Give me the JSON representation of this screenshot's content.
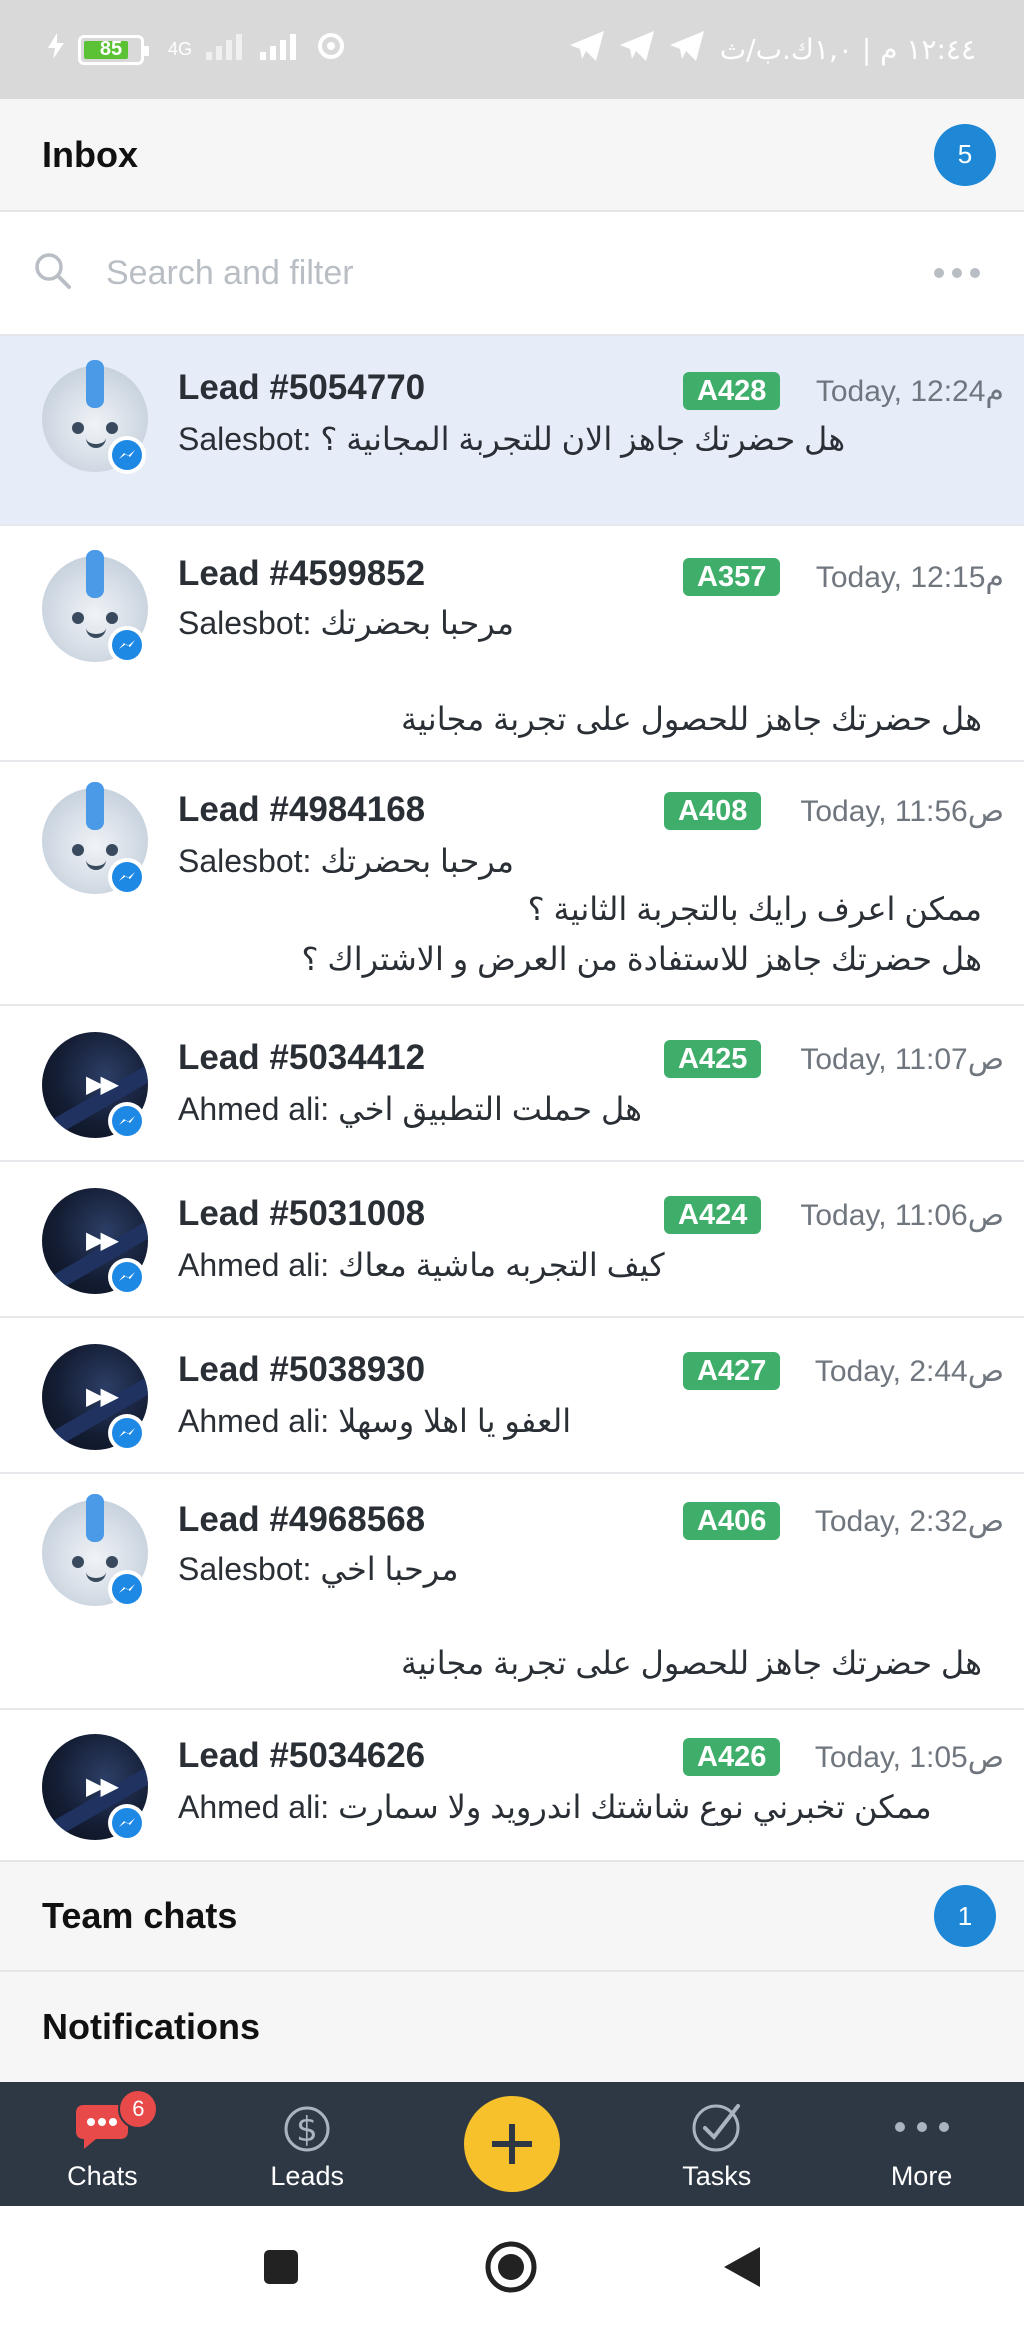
{
  "status_bar": {
    "right_text": "١٢:٤٤ م | ١,٠ك.ب/ث",
    "battery": "85",
    "network": "4G"
  },
  "inbox": {
    "title": "Inbox",
    "count": "5"
  },
  "search": {
    "placeholder": "Search and filter"
  },
  "conversations": [
    {
      "lead": "Lead #5054770",
      "tag": "A428",
      "time": "Today, 12:24م",
      "preview": "Salesbot: هل حضرتك جاهز الان للتجربة المجانية ؟",
      "extra": [],
      "avatar": "bot",
      "selected": true
    },
    {
      "lead": "Lead #4599852",
      "tag": "A357",
      "time": "Today, 12:15م",
      "preview": "Salesbot: مرحبا بحضرتك",
      "extra": [
        "هل حضرتك جاهز للحصول على تجربة مجانية"
      ],
      "avatar": "bot",
      "selected": false
    },
    {
      "lead": "Lead #4984168",
      "tag": "A408",
      "time": "Today, 11:56ص",
      "preview": "Salesbot: مرحبا بحضرتك",
      "extra": [
        "ممكن اعرف رايك بالتجربة الثانية ؟",
        "هل حضرتك جاهز للاستفادة من العرض و الاشتراك ؟"
      ],
      "avatar": "bot",
      "selected": false
    },
    {
      "lead": "Lead #5034412",
      "tag": "A425",
      "time": "Today, 11:07ص",
      "preview": "Ahmed ali: هل حملت التطبيق اخي",
      "extra": [],
      "avatar": "dark",
      "selected": false
    },
    {
      "lead": "Lead #5031008",
      "tag": "A424",
      "time": "Today, 11:06ص",
      "preview": "Ahmed ali: كيف التجربه ماشية معاك",
      "extra": [],
      "avatar": "dark",
      "selected": false
    },
    {
      "lead": "Lead #5038930",
      "tag": "A427",
      "time": "Today, 2:44ص",
      "preview": "Ahmed ali: العفو يا اهلا وسهلا",
      "extra": [],
      "avatar": "dark",
      "selected": false
    },
    {
      "lead": "Lead #4968568",
      "tag": "A406",
      "time": "Today, 2:32ص",
      "preview": "Salesbot: مرحبا اخي",
      "extra": [
        "هل حضرتك جاهز للحصول على تجربة مجانية"
      ],
      "avatar": "bot",
      "selected": false
    },
    {
      "lead": "Lead #5034626",
      "tag": "A426",
      "time": "Today, 1:05ص",
      "preview": "Ahmed ali: ممكن تخبرني نوع شاشتك اندرويد ولا سمارت",
      "extra": [],
      "avatar": "dark",
      "selected": false
    }
  ],
  "team_chats": {
    "title": "Team chats",
    "count": "1"
  },
  "notifications": {
    "title": "Notifications"
  },
  "bottom_nav": {
    "chats": "Chats",
    "chats_badge": "6",
    "leads": "Leads",
    "tasks": "Tasks",
    "more": "More"
  },
  "colors": {
    "accent": "#1e88d6",
    "tag_green": "#3fae6a",
    "selected_row": "#e6edf9",
    "nav_bg": "#2e3744",
    "fab": "#f6c12b",
    "badge_red": "#e84a4a"
  }
}
